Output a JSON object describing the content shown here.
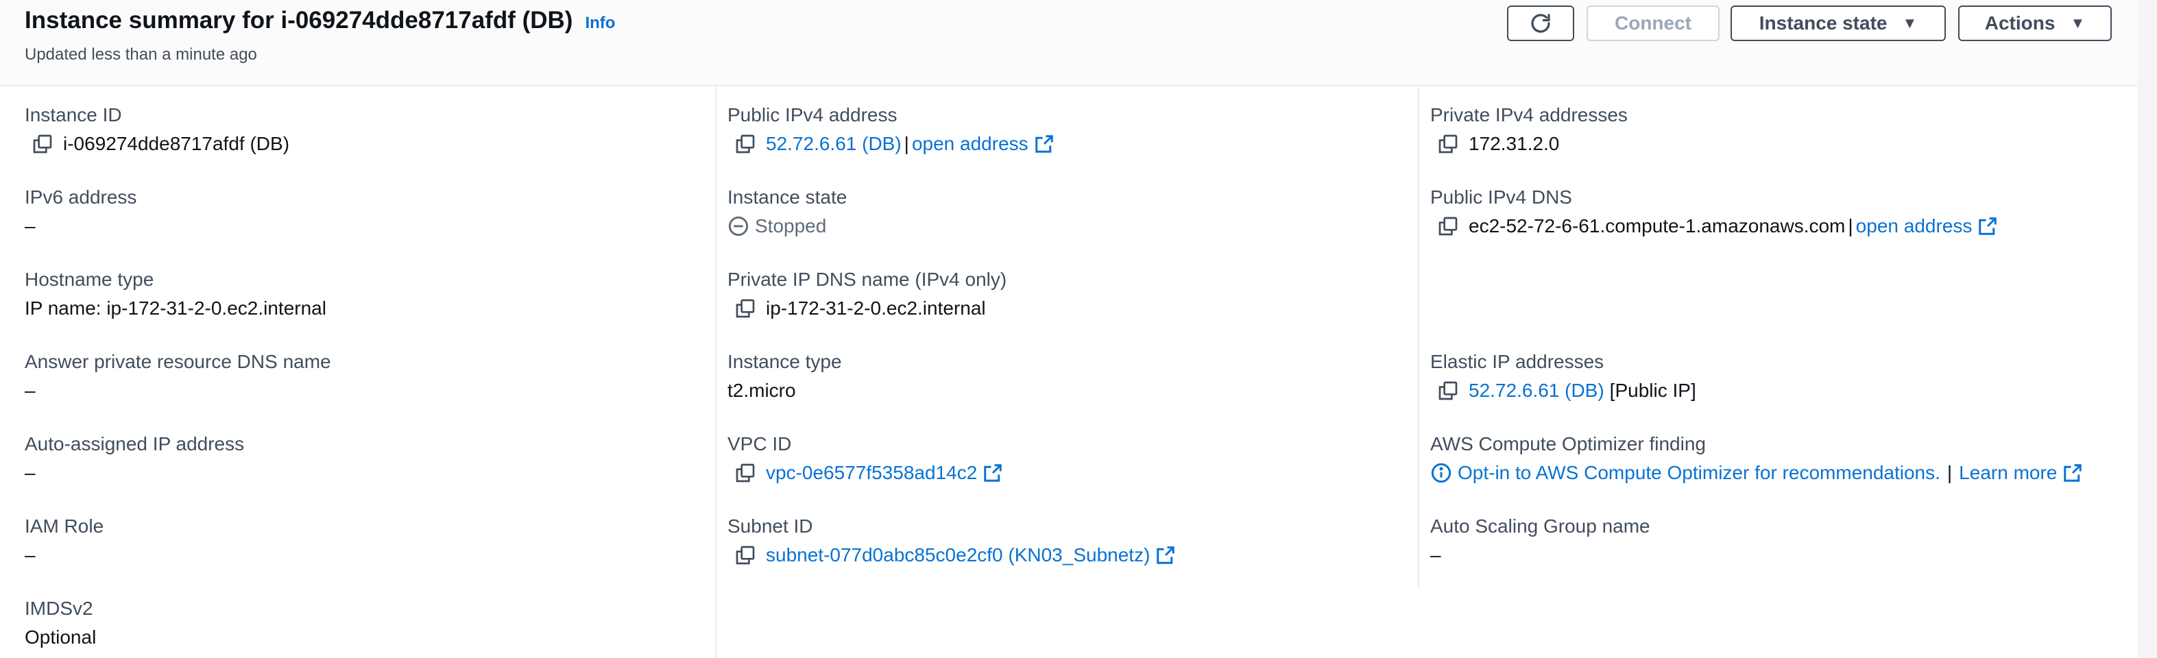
{
  "header": {
    "title": "Instance summary for i-069274dde8717afdf (DB)",
    "info_label": "Info",
    "subtitle": "Updated less than a minute ago",
    "buttons": {
      "connect": "Connect",
      "instance_state": "Instance state",
      "actions": "Actions"
    }
  },
  "col1": {
    "instance_id": {
      "label": "Instance ID",
      "value": "i-069274dde8717afdf (DB)"
    },
    "ipv6": {
      "label": "IPv6 address",
      "value": "–"
    },
    "hostname_type": {
      "label": "Hostname type",
      "value": "IP name: ip-172-31-2-0.ec2.internal"
    },
    "answer_dns": {
      "label": "Answer private resource DNS name",
      "value": "–"
    },
    "auto_ip": {
      "label": "Auto-assigned IP address",
      "value": "–"
    },
    "iam_role": {
      "label": "IAM Role",
      "value": "–"
    },
    "imdsv2": {
      "label": "IMDSv2",
      "value": "Optional"
    }
  },
  "col2": {
    "public_ipv4": {
      "label": "Public IPv4 address",
      "value": "52.72.6.61 (DB)",
      "separator": "|",
      "open_label": "open address"
    },
    "instance_state": {
      "label": "Instance state",
      "value": "Stopped"
    },
    "private_dns": {
      "label": "Private IP DNS name (IPv4 only)",
      "value": "ip-172-31-2-0.ec2.internal"
    },
    "instance_type": {
      "label": "Instance type",
      "value": "t2.micro"
    },
    "vpc_id": {
      "label": "VPC ID",
      "value": "vpc-0e6577f5358ad14c2"
    },
    "subnet_id": {
      "label": "Subnet ID",
      "value": "subnet-077d0abc85c0e2cf0 (KN03_Subnetz)"
    }
  },
  "col3": {
    "private_ipv4": {
      "label": "Private IPv4 addresses",
      "value": "172.31.2.0"
    },
    "public_dns": {
      "label": "Public IPv4 DNS",
      "value": "ec2-52-72-6-61.compute-1.amazonaws.com",
      "separator": "|",
      "open_label": "open address"
    },
    "elastic_ip": {
      "label": "Elastic IP addresses",
      "value": "52.72.6.61 (DB)",
      "suffix": "[Public IP]"
    },
    "optimizer": {
      "label": "AWS Compute Optimizer finding",
      "value": "Opt-in to AWS Compute Optimizer for recommendations.",
      "separator": "|",
      "learn_more": "Learn more"
    },
    "asg": {
      "label": "Auto Scaling Group name",
      "value": "–"
    }
  },
  "colors": {
    "link": "#0972d3",
    "text": "#0f141a",
    "label": "#414d5c",
    "divider": "#e9ebed"
  },
  "icons": [
    "refresh-icon",
    "caret-down-icon",
    "copy-icon",
    "external-link-icon",
    "stopped-status-icon",
    "info-circle-icon"
  ]
}
